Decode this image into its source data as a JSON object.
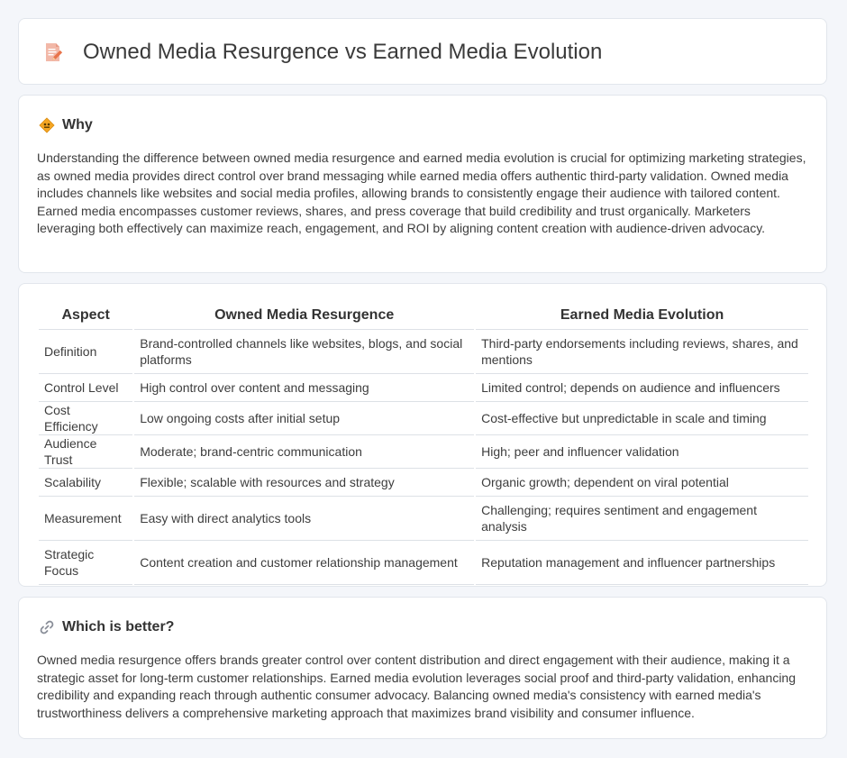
{
  "header": {
    "title": "Owned Media Resurgence vs Earned Media Evolution",
    "icon": "document-pencil-icon"
  },
  "why": {
    "title": "Why",
    "icon": "diamond-sign-icon",
    "text": "Understanding the difference between owned media resurgence and earned media evolution is crucial for optimizing marketing strategies, as owned media provides direct control over brand messaging while earned media offers authentic third-party validation. Owned media includes channels like websites and social media profiles, allowing brands to consistently engage their audience with tailored content. Earned media encompasses customer reviews, shares, and press coverage that build credibility and trust organically. Marketers leveraging both effectively can maximize reach, engagement, and ROI by aligning content creation with audience-driven advocacy."
  },
  "table": {
    "headers": [
      "Aspect",
      "Owned Media Resurgence",
      "Earned Media Evolution"
    ],
    "rows": [
      [
        "Definition",
        "Brand-controlled channels like websites, blogs, and social platforms",
        "Third-party endorsements including reviews, shares, and mentions"
      ],
      [
        "Control Level",
        "High control over content and messaging",
        "Limited control; depends on audience and influencers"
      ],
      [
        "Cost Efficiency",
        "Low ongoing costs after initial setup",
        "Cost-effective but unpredictable in scale and timing"
      ],
      [
        "Audience Trust",
        "Moderate; brand-centric communication",
        "High; peer and influencer validation"
      ],
      [
        "Scalability",
        "Flexible; scalable with resources and strategy",
        "Organic growth; dependent on viral potential"
      ],
      [
        "Measurement",
        "Easy with direct analytics tools",
        "Challenging; requires sentiment and engagement analysis"
      ],
      [
        "Strategic Focus",
        "Content creation and customer relationship management",
        "Reputation management and influencer partnerships"
      ]
    ]
  },
  "better": {
    "title": "Which is better?",
    "icon": "link-icon",
    "text": "Owned media resurgence offers brands greater control over content distribution and direct engagement with their audience, making it a strategic asset for long-term customer relationships. Earned media evolution leverages social proof and third-party validation, enhancing credibility and expanding reach through authentic consumer advocacy. Balancing owned media's consistency with earned media's trustworthiness delivers a comprehensive marketing approach that maximizes brand visibility and consumer influence."
  }
}
